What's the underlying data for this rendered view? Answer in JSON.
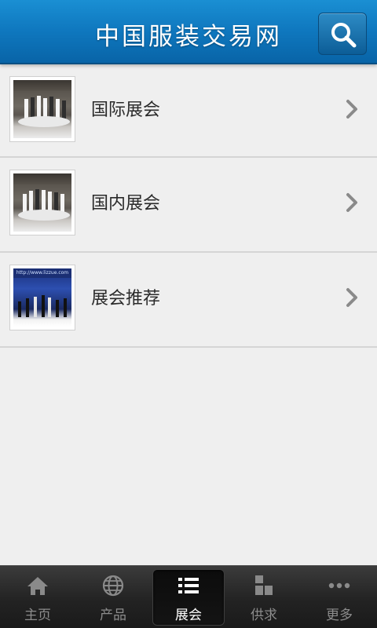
{
  "header": {
    "title": "中国服装交易网",
    "search_icon": "search-icon",
    "colors": {
      "bar": "#0f78bf",
      "bar_dark": "#0864a7"
    }
  },
  "list": {
    "items": [
      {
        "label": "国际展会",
        "thumb_icon": "exhibition-hall-photo"
      },
      {
        "label": "国内展会",
        "thumb_icon": "exhibition-hall-photo"
      },
      {
        "label": "展会推荐",
        "thumb_icon": "fashion-runway-photo",
        "thumb_caption": "http://www.lizzue.com"
      }
    ],
    "chevron_icon": "chevron-right-icon"
  },
  "tabbar": {
    "tabs": [
      {
        "label": "主页",
        "icon": "home-icon",
        "active": false
      },
      {
        "label": "产品",
        "icon": "globe-icon",
        "active": false
      },
      {
        "label": "展会",
        "icon": "list-icon",
        "active": true
      },
      {
        "label": "供求",
        "icon": "blocks-icon",
        "active": false
      },
      {
        "label": "更多",
        "icon": "more-icon",
        "active": false
      }
    ],
    "colors": {
      "active_label": "#ffffff",
      "inactive_label": "#8c8c8c"
    }
  }
}
